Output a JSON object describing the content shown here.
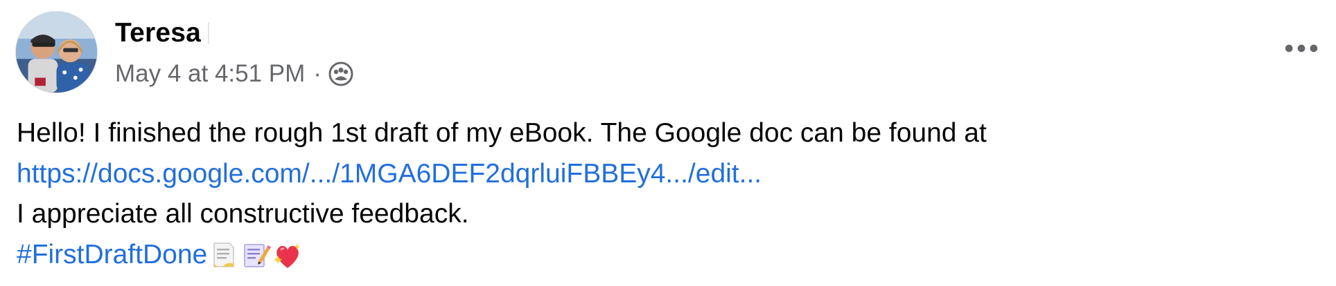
{
  "post": {
    "author": "Teresa",
    "timestamp": "May 4 at 4:51 PM",
    "separator": "·",
    "audience_icon": "group-icon",
    "more_icon": "more-options-icon",
    "body": {
      "line1": "Hello! I finished the rough 1st draft of my eBook. The Google doc can be found at",
      "link": "https://docs.google.com/.../1MGA6DEF2dqrluiFBBEy4.../edit...",
      "line3": "I appreciate all constructive feedback.",
      "hashtag": "#FirstDraftDone",
      "emojis": [
        "page-with-curl-emoji",
        "memo-emoji",
        "sparkling-heart-emoji"
      ]
    }
  },
  "colors": {
    "text": "#050505",
    "secondary_text": "#65676b",
    "link": "#216fdb"
  }
}
